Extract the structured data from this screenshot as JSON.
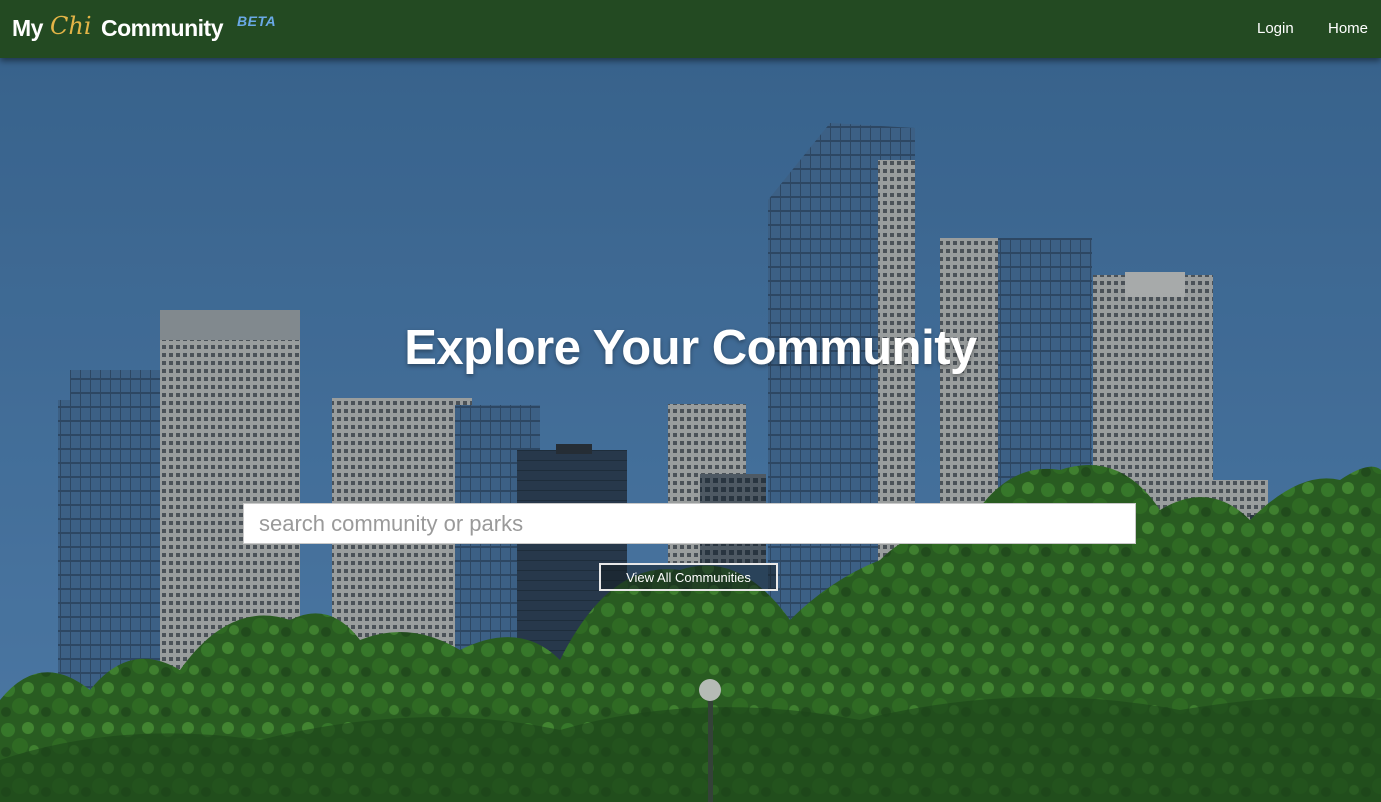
{
  "brand": {
    "my": "My",
    "chi": "Chi",
    "community": "Community",
    "beta": "BETA"
  },
  "nav": {
    "login": "Login",
    "home": "Home"
  },
  "hero": {
    "title": "Explore Your Community",
    "search_placeholder": "search community or parks",
    "search_value": "",
    "view_all_label": "View All Communities"
  },
  "colors": {
    "navbar": "#234a22",
    "brand_chi": "#e3b447",
    "brand_beta": "#6aa9e6",
    "sky": "#4a7fb2"
  }
}
